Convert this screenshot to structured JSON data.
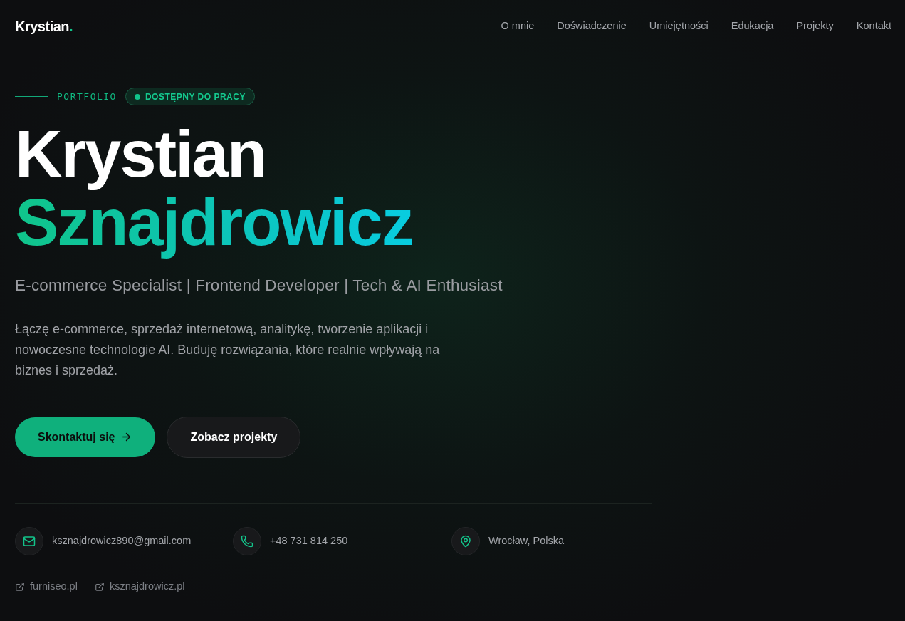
{
  "nav": {
    "logo": {
      "text": "Krystian",
      "accent": "."
    },
    "links": [
      {
        "label": "O mnie"
      },
      {
        "label": "Doświadczenie"
      },
      {
        "label": "Umiejętności"
      },
      {
        "label": "Edukacja"
      },
      {
        "label": "Projekty"
      },
      {
        "label": "Kontakt"
      }
    ]
  },
  "hero": {
    "eyebrow": "PORTFOLIO",
    "status_badge": {
      "label": "DOSTĘPNY DO PRACY"
    },
    "name_first": "Krystian",
    "name_last": "Sznajdrowicz",
    "subtitle": "E-commerce Specialist | Frontend Developer | Tech & AI Enthusiast",
    "description": "Łączę e-commerce, sprzedaż internetową, analitykę, tworzenie aplikacji i nowoczesne technologie AI. Buduję rozwiązania, które realnie wpływają na biznes i sprzedaż.",
    "buttons": [
      {
        "kind": "primary",
        "label": "Skontaktuj się"
      },
      {
        "kind": "secondary",
        "label": "Zobacz projekty"
      }
    ]
  },
  "contacts": [
    {
      "kind": "email",
      "value": "ksznajdrowicz890@gmail.com"
    },
    {
      "kind": "phone",
      "value": "+48 731 814 250"
    },
    {
      "kind": "location",
      "value": "Wrocław, Polska"
    }
  ],
  "links": [
    {
      "label": "furniseo.pl"
    },
    {
      "label": "ksznajdrowicz.pl"
    }
  ]
}
